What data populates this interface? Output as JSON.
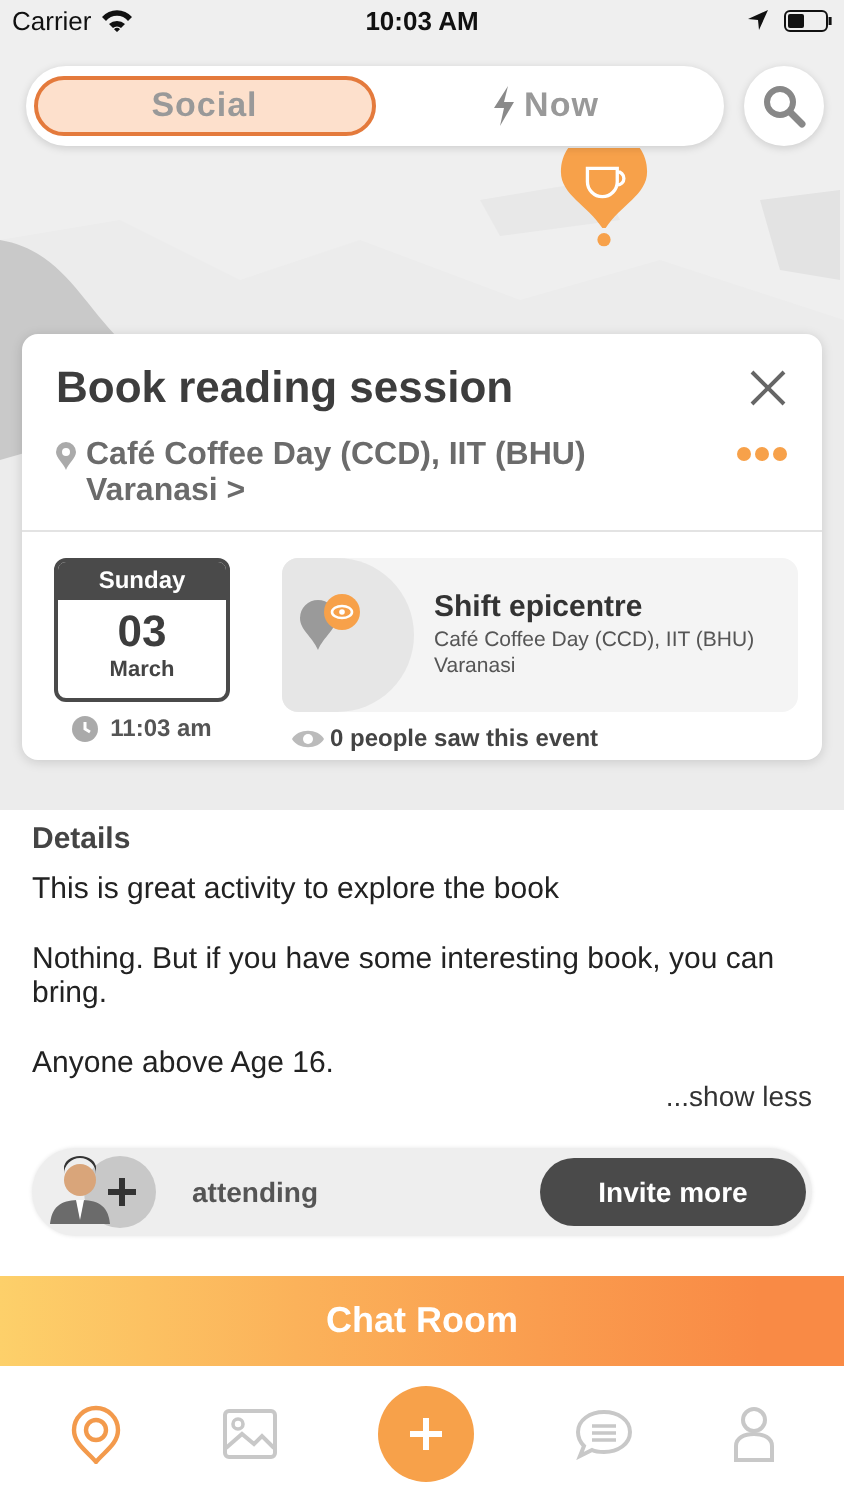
{
  "status_bar": {
    "carrier": "Carrier",
    "time": "10:03 AM"
  },
  "mode_tabs": [
    {
      "label": "Social",
      "selected": true,
      "kind": "text"
    },
    {
      "label": "Now",
      "selected": false,
      "kind": "bolt"
    }
  ],
  "event": {
    "title": "Book reading session",
    "location": "Café Coffee Day (CCD), IIT (BHU) Varanasi >",
    "date": {
      "weekday": "Sunday",
      "day": "03",
      "month": "March"
    },
    "time": "11:03 am",
    "venue": {
      "name": "Shift epicentre",
      "address": "Café Coffee Day (CCD), IIT (BHU) Varanasi"
    },
    "views": "0 people saw this event"
  },
  "details": {
    "heading": "Details",
    "paragraphs": [
      "This is great activity to explore the book",
      "Nothing. But if you have some interesting book, you can bring.",
      "Anyone above Age 16."
    ],
    "toggle": "...show less"
  },
  "attendance": {
    "label": "attending",
    "button": "Invite more"
  },
  "chat_button": "Chat Room",
  "nav": [
    {
      "kind": "map",
      "selected": true
    },
    {
      "kind": "gallery",
      "selected": false
    },
    {
      "kind": "add",
      "selected": false
    },
    {
      "kind": "chat",
      "selected": false
    },
    {
      "kind": "profile",
      "selected": false
    }
  ]
}
